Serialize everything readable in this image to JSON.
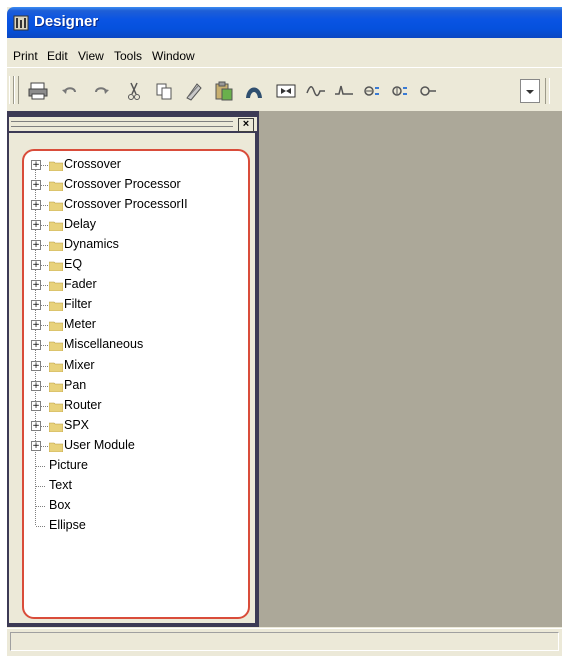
{
  "window": {
    "title": "Designer"
  },
  "menu": [
    {
      "label": "Print",
      "name": "menu-print"
    },
    {
      "label": "Edit",
      "name": "menu-edit"
    },
    {
      "label": "View",
      "name": "menu-view"
    },
    {
      "label": "Tools",
      "name": "menu-tools"
    },
    {
      "label": "Window",
      "name": "menu-window"
    }
  ],
  "toolbar": {
    "icons": [
      "print-icon",
      "undo-icon",
      "redo-icon",
      "cut-icon",
      "copy-icon",
      "paste-icon",
      "clipboard-icon",
      "curve-icon",
      "mixer-icon",
      "wave-icon",
      "signal-icon",
      "input-icon",
      "output-icon",
      "connector-icon",
      "dropdown-icon"
    ]
  },
  "panel": {
    "close_label": "×",
    "tree": {
      "folders": [
        "Crossover",
        "Crossover Processor",
        "Crossover ProcessorII",
        "Delay",
        "Dynamics",
        "EQ",
        "Fader",
        "Filter",
        "Meter",
        "Miscellaneous",
        "Mixer",
        "Pan",
        "Router",
        "SPX",
        "User Module"
      ],
      "leaves": [
        "Picture",
        "Text",
        "Box",
        "Ellipse"
      ],
      "expander_symbol": "+"
    }
  },
  "colors": {
    "title_bar": "#0a54e3",
    "highlight_border": "#d94c3a",
    "workspace": "#aca899",
    "folder": "#e8d27c"
  }
}
